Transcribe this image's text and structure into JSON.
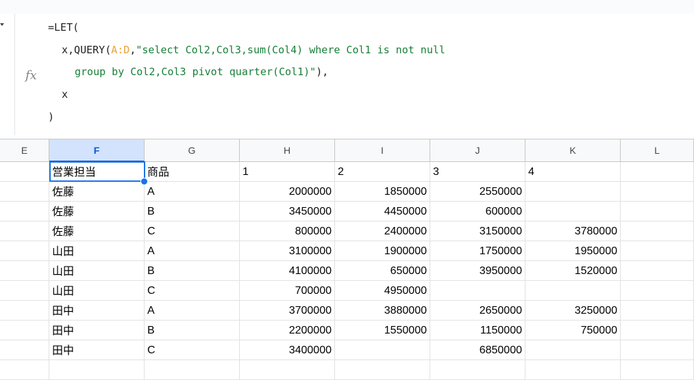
{
  "formula": {
    "fx_label": "fx",
    "line1": "=LET(",
    "line2_prefix": "x,QUERY(",
    "line2_range": "A:D",
    "line2_sep": ",",
    "line2_string": "\"select Col2,Col3,sum(Col4) where Col1 is not null",
    "line3_string": "group by Col2,Col3 pivot quarter(Col1)\"",
    "line3_suffix": "),",
    "line4": "x",
    "line5": ")"
  },
  "columns": [
    "E",
    "F",
    "G",
    "H",
    "I",
    "J",
    "K",
    "L"
  ],
  "selected_column": "F",
  "header_row": [
    "",
    "営業担当",
    "商品",
    "1",
    "2",
    "3",
    "4",
    ""
  ],
  "rows": [
    [
      "",
      "佐藤",
      "A",
      "2000000",
      "1850000",
      "2550000",
      "",
      ""
    ],
    [
      "",
      "佐藤",
      "B",
      "3450000",
      "4450000",
      "600000",
      "",
      ""
    ],
    [
      "",
      "佐藤",
      "C",
      "800000",
      "2400000",
      "3150000",
      "3780000",
      ""
    ],
    [
      "",
      "山田",
      "A",
      "3100000",
      "1900000",
      "1750000",
      "1950000",
      ""
    ],
    [
      "",
      "山田",
      "B",
      "4100000",
      "650000",
      "3950000",
      "1520000",
      ""
    ],
    [
      "",
      "山田",
      "C",
      "700000",
      "4950000",
      "",
      "",
      ""
    ],
    [
      "",
      "田中",
      "A",
      "3700000",
      "3880000",
      "2650000",
      "3250000",
      ""
    ],
    [
      "",
      "田中",
      "B",
      "2200000",
      "1550000",
      "1150000",
      "750000",
      ""
    ],
    [
      "",
      "田中",
      "C",
      "3400000",
      "",
      "6850000",
      "",
      ""
    ],
    [
      "",
      "",
      "",
      "",
      "",
      "",
      "",
      ""
    ]
  ],
  "colors": {
    "selection": "#1a73e8",
    "range_ref": "#e8a33c",
    "string_literal": "#188038"
  }
}
